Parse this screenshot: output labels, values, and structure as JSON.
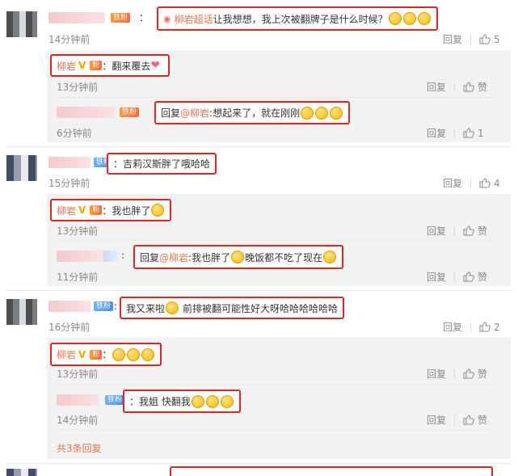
{
  "comments": [
    {
      "id": "c1",
      "loc_tag": "柳岩超话",
      "text": "让我想想，我上次被翻牌子是什么时候？",
      "time": "14分钟前",
      "reply_label": "回复",
      "likes": "5"
    },
    {
      "id": "c2",
      "text": "吉莉汉斯胖了哦哈哈",
      "fan_label": "铁粉",
      "time": "15分钟前",
      "reply_label": "回复",
      "likes": "4"
    },
    {
      "id": "c3",
      "text": "我又来啦",
      "text2": "前排被翻可能性好大呀哈哈哈哈哈哈",
      "fan_label": "铁粉",
      "time": "16分钟前",
      "reply_label": "回复",
      "likes": "2"
    }
  ],
  "replies": [
    {
      "id": "r1",
      "author": "柳岩",
      "text": "翻来覆去",
      "time": "13分钟前",
      "reply_label": "回复",
      "like_label": "赞"
    },
    {
      "id": "r2",
      "fan_label": "铁粉",
      "prefix": "回复",
      "mention": "@柳岩",
      "text": ":想起来了，就在刚刚",
      "time": "6分钟前",
      "reply_label": "回复",
      "likes": "1"
    },
    {
      "id": "r3",
      "author": "柳岩",
      "text": "我也胖了",
      "time": "13分钟前",
      "reply_label": "回复",
      "like_label": "赞"
    },
    {
      "id": "r4",
      "prefix": "回复",
      "mention": "@柳岩",
      "text": ":我也胖了",
      "text2": "晚饭都不吃了现在",
      "time": "11分钟前",
      "reply_label": "回复",
      "like_label": "赞"
    },
    {
      "id": "r5",
      "author": "柳岩",
      "text": "",
      "time": "13分钟前",
      "reply_label": "回复",
      "like_label": "赞"
    },
    {
      "id": "r6",
      "fan_label": "铁粉",
      "text": "我姐 快翻我",
      "time": "14分钟前",
      "reply_label": "回复",
      "like_label": "赞"
    }
  ],
  "more_replies": "共3条回复",
  "colon": "：",
  "vip_mark": "V",
  "colors": {
    "highlight_box": "#e0261f",
    "username": "#eb7350",
    "sub_bg": "#f2f2f2"
  },
  "icons": [
    "thumbs-up-icon",
    "location-pin-icon",
    "emoji-icon",
    "heart-icon",
    "vip-badge-icon",
    "fan-badge-icon"
  ]
}
